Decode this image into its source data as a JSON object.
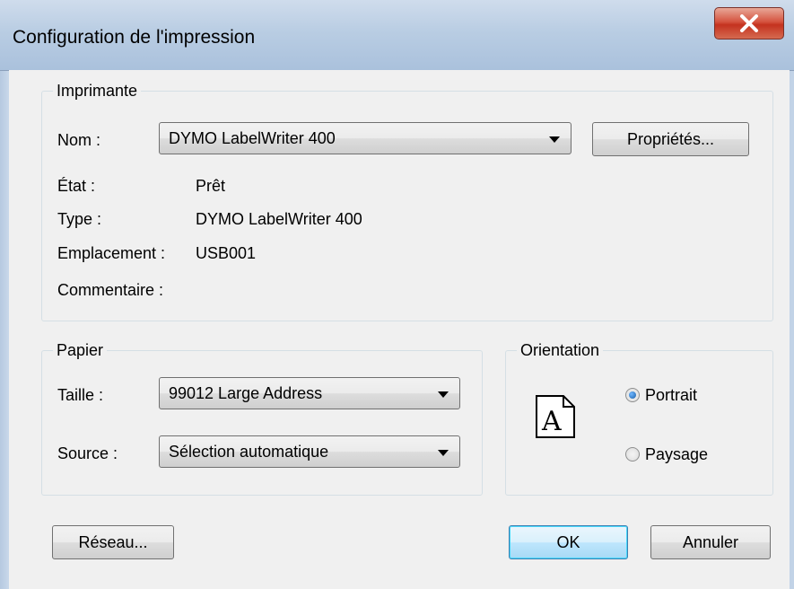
{
  "window": {
    "title": "Configuration de l'impression"
  },
  "printer": {
    "group_label": "Imprimante",
    "name_label": "Nom :",
    "name_value": "DYMO LabelWriter 400",
    "properties_button": "Propriétés...",
    "status_label": "État :",
    "status_value": "Prêt",
    "type_label": "Type :",
    "type_value": "DYMO LabelWriter 400",
    "location_label": "Emplacement :",
    "location_value": "USB001",
    "comment_label": "Commentaire :",
    "comment_value": ""
  },
  "paper": {
    "group_label": "Papier",
    "size_label": "Taille :",
    "size_value": "99012 Large Address",
    "source_label": "Source :",
    "source_value": "Sélection automatique"
  },
  "orientation": {
    "group_label": "Orientation",
    "icon_letter": "A",
    "portrait_label": "Portrait",
    "landscape_label": "Paysage",
    "selected": "portrait"
  },
  "buttons": {
    "network": "Réseau...",
    "ok": "OK",
    "cancel": "Annuler"
  },
  "colors": {
    "close_button": "#c4321f",
    "default_button_border": "#3c7fb1",
    "dialog_background": "#f0f0f0"
  }
}
